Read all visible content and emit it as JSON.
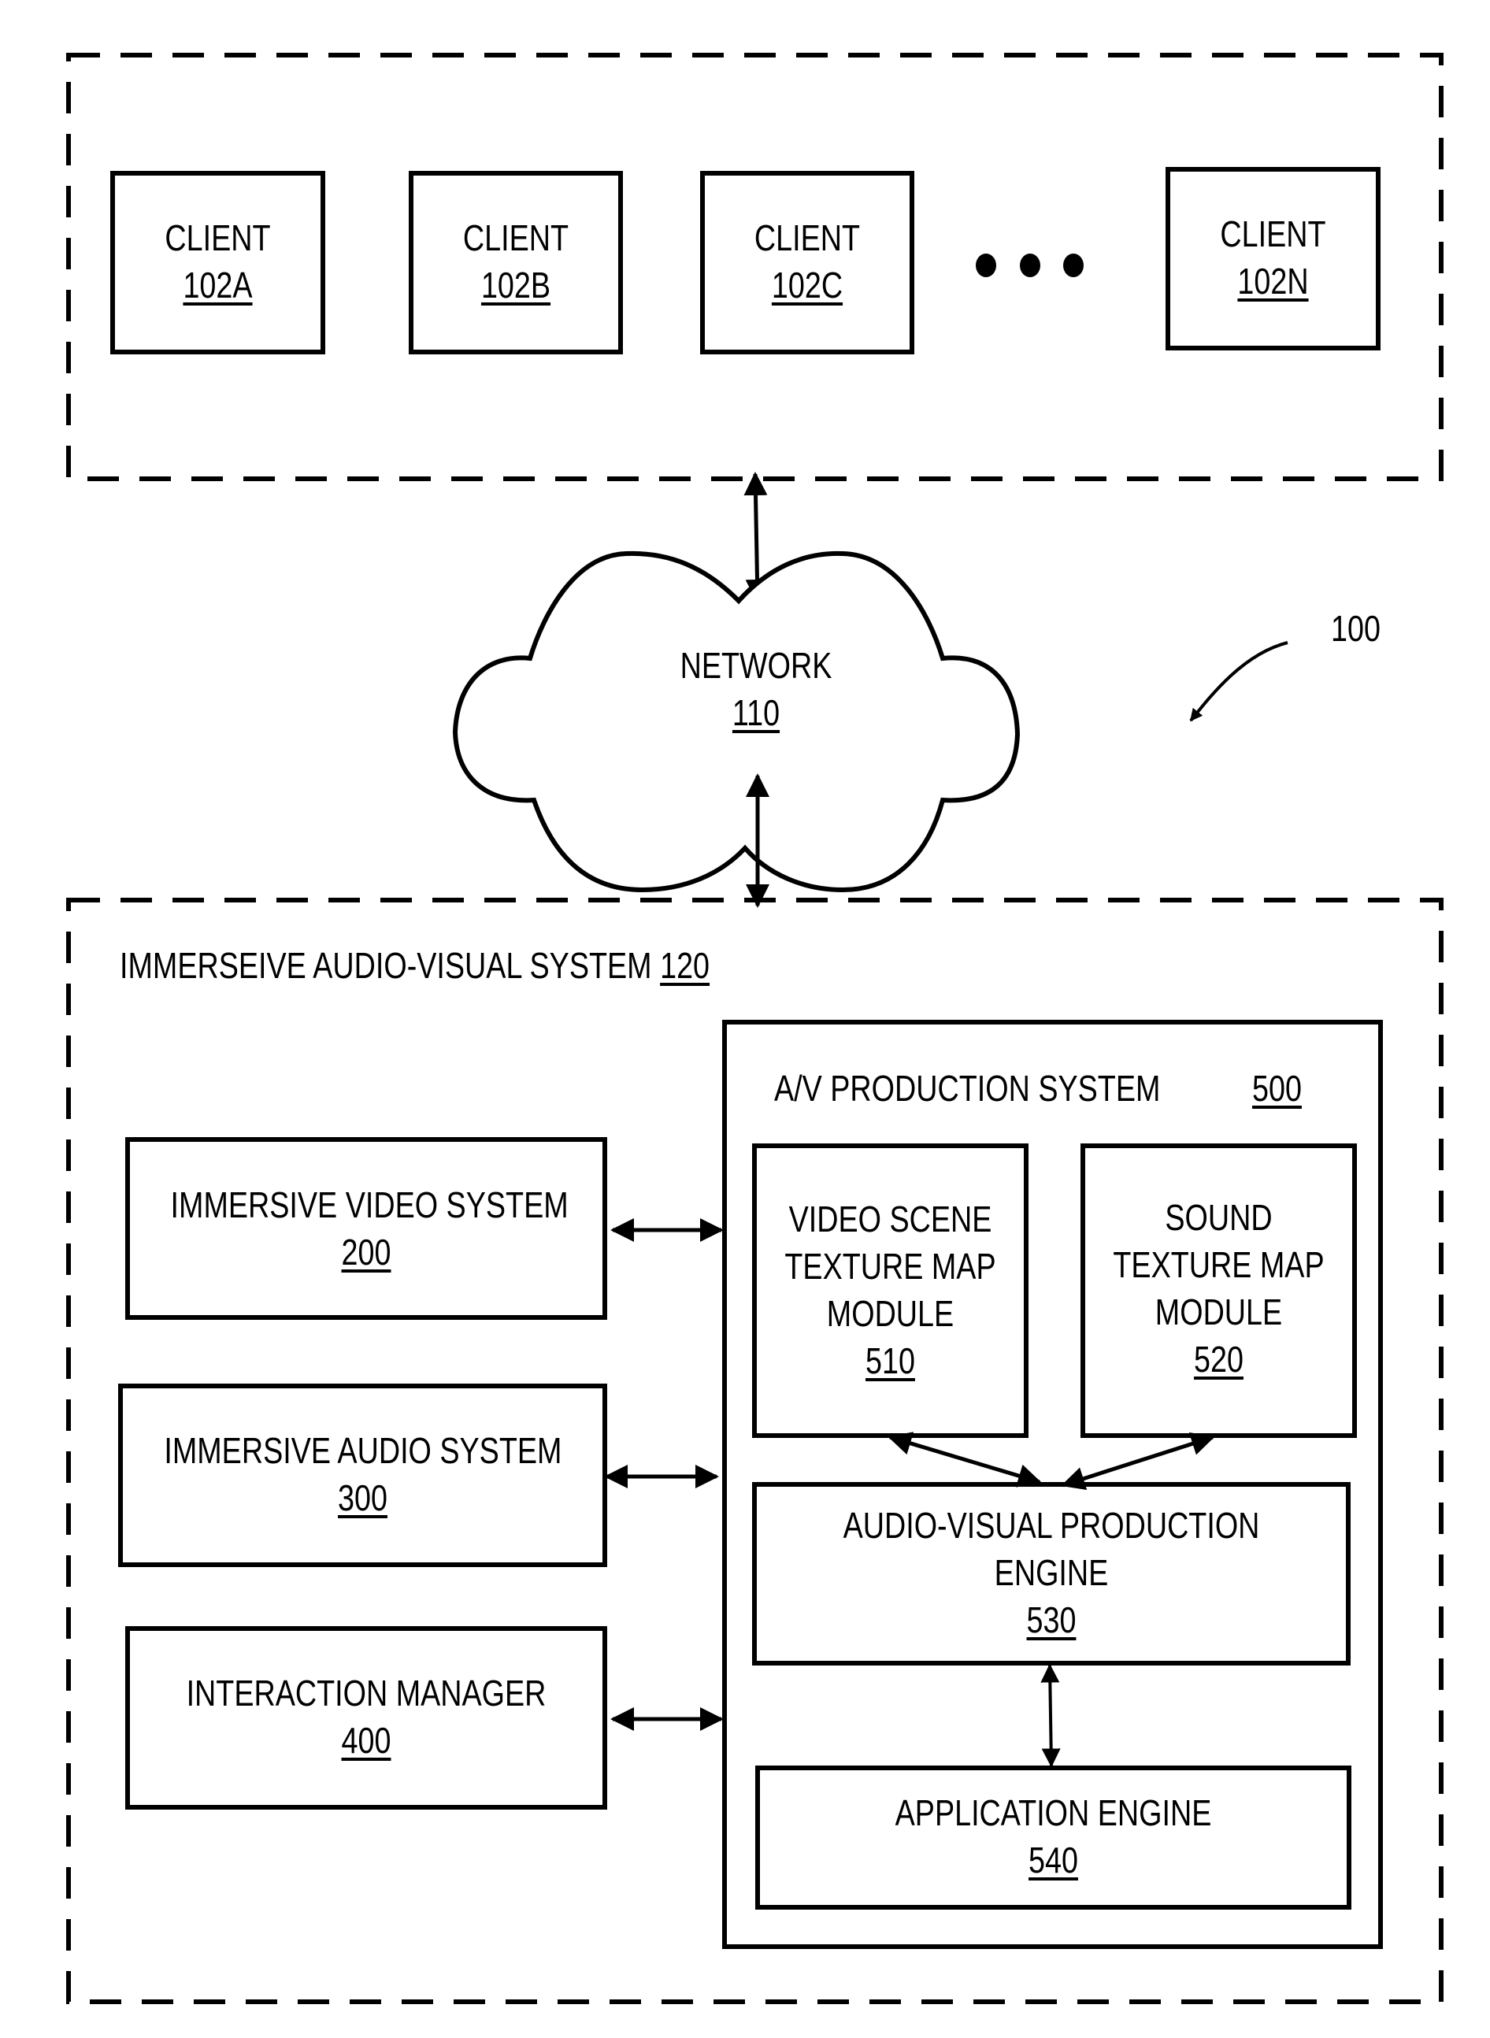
{
  "figure_ref": "100",
  "clients_group": {
    "clients": [
      {
        "label": "CLIENT",
        "ref": "102A"
      },
      {
        "label": "CLIENT",
        "ref": "102B"
      },
      {
        "label": "CLIENT",
        "ref": "102C"
      },
      {
        "label": "CLIENT",
        "ref": "102N"
      }
    ],
    "ellipsis": "•••"
  },
  "network": {
    "label": "NETWORK",
    "ref": "110"
  },
  "system": {
    "title": "IMMERSEIVE AUDIO-VISUAL SYSTEM",
    "ref": "120",
    "left_boxes": [
      {
        "label": "IMMERSIVE VIDEO SYSTEM",
        "ref": "200"
      },
      {
        "label": "IMMERSIVE AUDIO SYSTEM",
        "ref": "300"
      },
      {
        "label": "INTERACTION MANAGER",
        "ref": "400"
      }
    ],
    "av_production": {
      "title": "A/V PRODUCTION SYSTEM",
      "ref": "500",
      "modules": {
        "video_texture": {
          "lines": [
            "VIDEO SCENE",
            "TEXTURE MAP",
            "MODULE"
          ],
          "ref": "510"
        },
        "sound_texture": {
          "lines": [
            "SOUND",
            "TEXTURE MAP",
            "MODULE"
          ],
          "ref": "520"
        },
        "av_engine": {
          "lines": [
            "AUDIO-VISUAL PRODUCTION",
            "ENGINE"
          ],
          "ref": "530"
        },
        "app_engine": {
          "lines": [
            "APPLICATION ENGINE"
          ],
          "ref": "540"
        }
      }
    }
  }
}
